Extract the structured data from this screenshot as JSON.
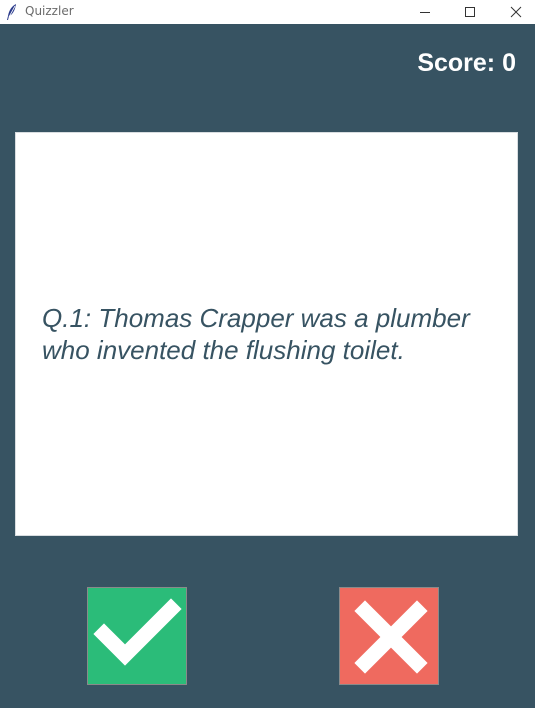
{
  "window": {
    "title": "Quizzler",
    "icon": "feather-icon",
    "controls": [
      "minimize-icon",
      "maximize-icon",
      "close-icon"
    ]
  },
  "score": {
    "label": "Score: 0"
  },
  "question": {
    "text": "Q.1: Thomas Crapper was a plumber who invented the flushing toilet."
  },
  "buttons": {
    "true": {
      "icon": "checkmark-icon",
      "color": "#2bbc79"
    },
    "false": {
      "icon": "x-mark-icon",
      "color": "#ef6a5f"
    }
  },
  "colors": {
    "background": "#375362",
    "card": "#ffffff",
    "question_text": "#375362",
    "score_text": "#ffffff"
  }
}
